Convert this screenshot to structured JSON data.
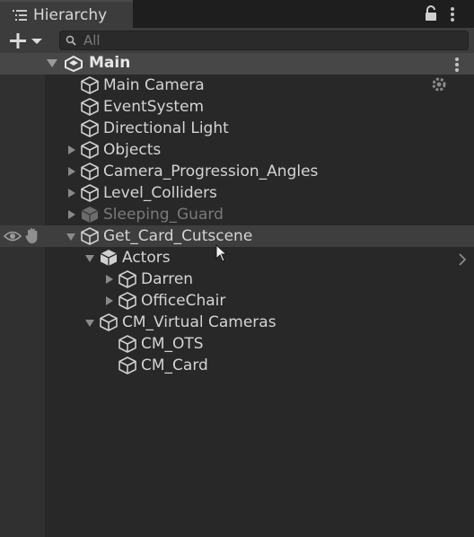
{
  "window": {
    "tab_title": "Hierarchy",
    "icons": [
      "list-icon",
      "lock-icon",
      "kebab-menu-icon"
    ]
  },
  "toolbar": {
    "add_button_icons": [
      "plus-icon",
      "dropdown-caret-icon"
    ],
    "search_placeholder": "All"
  },
  "scene": {
    "name": "Main",
    "expanded": true
  },
  "items": [
    {
      "label": "Main Camera",
      "depth": 0,
      "expander": "none"
    },
    {
      "label": "EventSystem",
      "depth": 0,
      "expander": "none"
    },
    {
      "label": "Directional Light",
      "depth": 0,
      "expander": "none"
    },
    {
      "label": "Objects",
      "depth": 0,
      "expander": "collapsed"
    },
    {
      "label": "Camera_Progression_Angles",
      "depth": 0,
      "expander": "collapsed"
    },
    {
      "label": "Level_Colliders",
      "depth": 0,
      "expander": "collapsed"
    },
    {
      "label": "Sleeping_Guard",
      "depth": 0,
      "expander": "collapsed",
      "disabled": true
    },
    {
      "label": "Get_Card_Cutscene",
      "depth": 0,
      "expander": "expanded",
      "hovered": true
    },
    {
      "label": "Actors",
      "depth": 1,
      "expander": "expanded",
      "prefab": true
    },
    {
      "label": "Darren",
      "depth": 2,
      "expander": "collapsed"
    },
    {
      "label": "OfficeChair",
      "depth": 2,
      "expander": "collapsed"
    },
    {
      "label": "CM_Virtual Cameras",
      "depth": 1,
      "expander": "expanded"
    },
    {
      "label": "CM_OTS",
      "depth": 2,
      "expander": "none"
    },
    {
      "label": "CM_Card",
      "depth": 2,
      "expander": "none"
    }
  ],
  "colors": {
    "background": "#282828",
    "header": "#3c3c3c",
    "scene_row": "#474747",
    "text": "#d4d4d4",
    "disabled_text": "#7a7a7a"
  }
}
